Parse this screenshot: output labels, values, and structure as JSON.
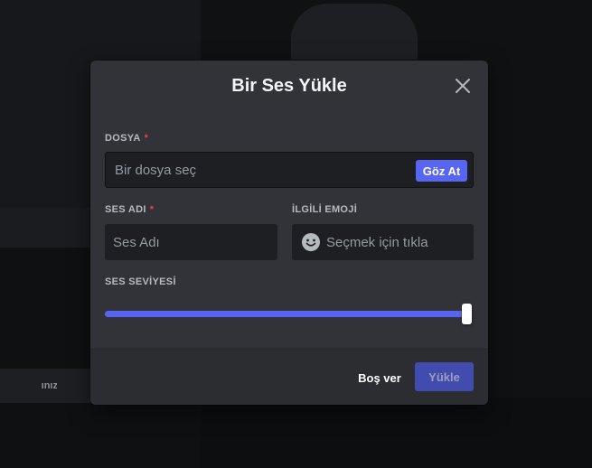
{
  "background": {
    "button_1_label": "ınız"
  },
  "modal": {
    "title": "Bir Ses Yükle",
    "file": {
      "label": "DOSYA",
      "required_mark": "*",
      "placeholder": "Bir dosya seç",
      "browse_label": "Göz At"
    },
    "sound_name": {
      "label": "SES ADI",
      "required_mark": "*",
      "placeholder": "Ses Adı"
    },
    "related_emoji": {
      "label": "İLGİLİ EMOJİ",
      "placeholder": "Seçmek için tıkla",
      "icon": "smiley-icon"
    },
    "volume": {
      "label": "SES SEVİYESİ",
      "level_percent": 100
    },
    "footer": {
      "cancel_label": "Boş ver",
      "upload_label": "Yükle"
    },
    "colors": {
      "accent": "#5865f2",
      "required": "#f23f43",
      "modal_bg": "#313338",
      "footer_bg": "#2b2d31"
    }
  }
}
